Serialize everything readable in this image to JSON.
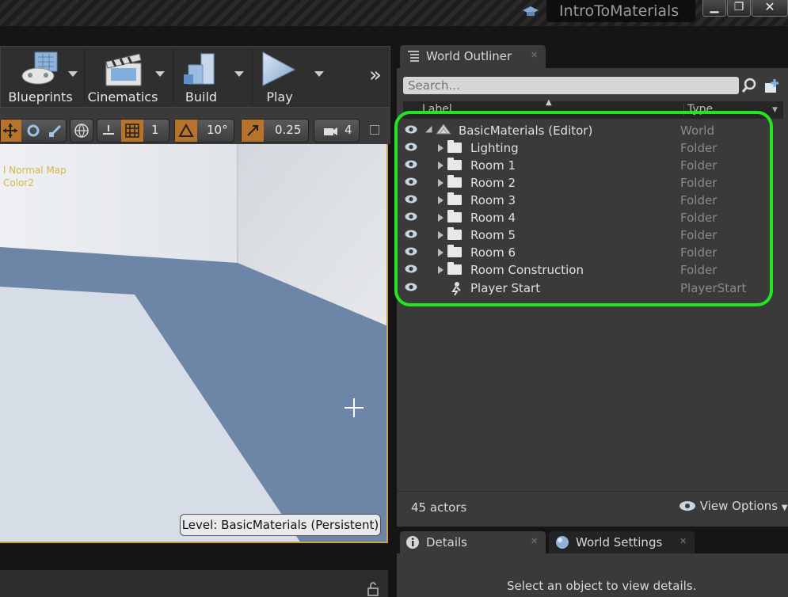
{
  "window": {
    "title": "IntroToMaterials",
    "min_glyph": "▁",
    "max_glyph": "❐",
    "close_glyph": "✕"
  },
  "toolbar": {
    "blueprints_label": "Blueprints",
    "cinematics_label": "Cinematics",
    "build_label": "Build",
    "play_label": "Play",
    "overflow_glyph": "»"
  },
  "viewport_toolbar": {
    "grid_snap_value": "1",
    "rotation_snap_value": "10°",
    "scale_snap_value": "0.25",
    "camera_speed_value": "4"
  },
  "viewport": {
    "debug_lines": [
      "l Normal Map",
      "Color2"
    ],
    "level_label": "Level:",
    "level_name": "BasicMaterials (Persistent)",
    "colors": {
      "wall": "#e3e6ea",
      "floor_shadow": "#6d86a8",
      "floor_light": "#d6dde6"
    }
  },
  "outliner": {
    "tab_label": "World Outliner",
    "search": {
      "placeholder": "Search...",
      "value": ""
    },
    "columns": {
      "label": "Label",
      "type": "Type"
    },
    "rows": [
      {
        "label": "BasicMaterials (Editor)",
        "type": "World"
      },
      {
        "label": "Lighting",
        "type": "Folder"
      },
      {
        "label": "Room 1",
        "type": "Folder"
      },
      {
        "label": "Room 2",
        "type": "Folder"
      },
      {
        "label": "Room 3",
        "type": "Folder"
      },
      {
        "label": "Room 4",
        "type": "Folder"
      },
      {
        "label": "Room 5",
        "type": "Folder"
      },
      {
        "label": "Room 6",
        "type": "Folder"
      },
      {
        "label": "Room Construction",
        "type": "Folder"
      },
      {
        "label": "Player Start",
        "type": "PlayerStart"
      }
    ],
    "actor_count": "45 actors",
    "view_options_label": "View Options",
    "highlight_color": "#22e622"
  },
  "details": {
    "tab_label": "Details",
    "world_settings_tab_label": "World Settings",
    "empty_message": "Select an object to view details."
  }
}
